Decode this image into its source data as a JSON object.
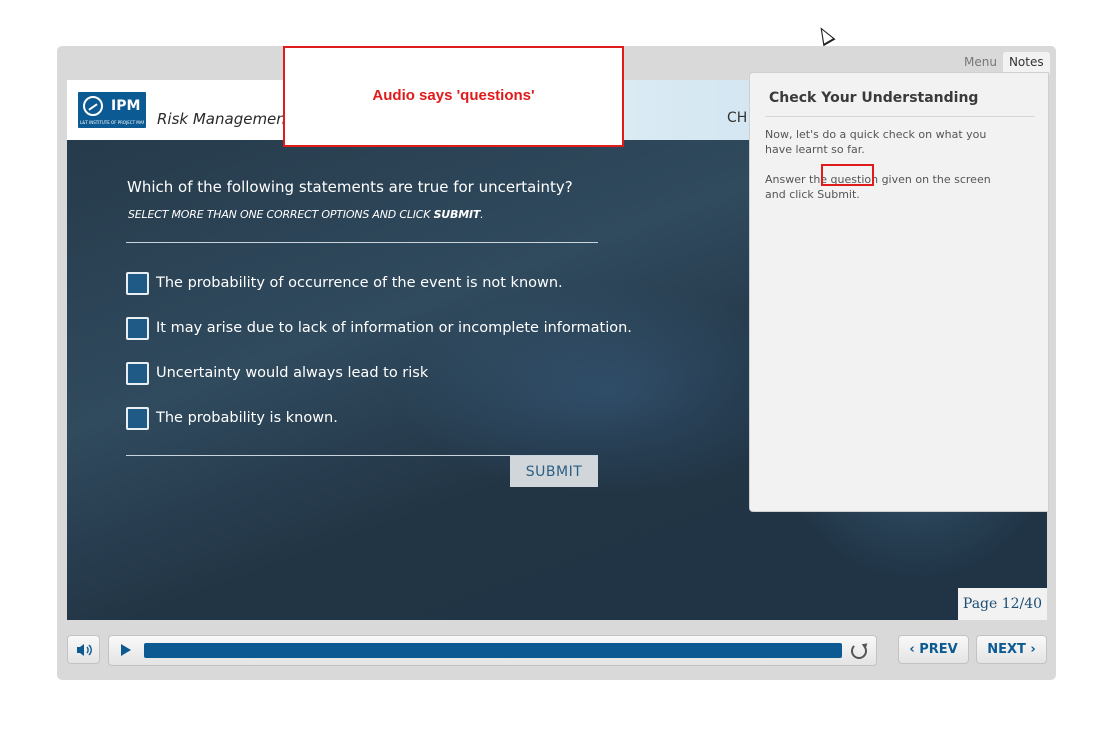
{
  "header": {
    "logo_text": "IPM",
    "logo_subtext": "L&T INSTITUTE OF PROJECT MANAGEMENT",
    "course_title": "Risk Management",
    "chapter_partial": "CH"
  },
  "audio_callout": {
    "text": "Audio says 'questions'"
  },
  "question": {
    "prompt": "Which of the following statements are true for uncertainty?",
    "instruction_prefix": "SELECT MORE THAN ONE CORRECT OPTIONS AND CLICK ",
    "instruction_bold": "SUBMIT",
    "instruction_suffix": ".",
    "options": [
      {
        "label": "The probability of occurrence of the event is not known.",
        "checked": false
      },
      {
        "label": "It may arise due to lack of information or incomplete information.",
        "checked": false
      },
      {
        "label": "Uncertainty would always lead to risk",
        "checked": false
      },
      {
        "label": "The probability is known.",
        "checked": false
      }
    ],
    "submit_label": "SUBMIT"
  },
  "page_indicator": "Page 12/40",
  "panel": {
    "tabs": [
      {
        "label": "Menu",
        "active": false
      },
      {
        "label": "Notes",
        "active": true
      }
    ],
    "title": "Check Your Understanding",
    "paragraph1": "Now, let's do a quick check on what you have learnt so far.",
    "paragraph2": "Answer the question given on the screen and click Submit."
  },
  "controls": {
    "audio_icon": "speaker-icon",
    "play_icon": "play-icon",
    "replay_icon": "replay-icon",
    "progress_fraction": 1.0,
    "prev_label": "PREV",
    "next_label": "NEXT"
  },
  "colors": {
    "brand_blue": "#0d5a92",
    "callout_red": "#e01b1b",
    "panel_bg": "#f2f2f2"
  }
}
